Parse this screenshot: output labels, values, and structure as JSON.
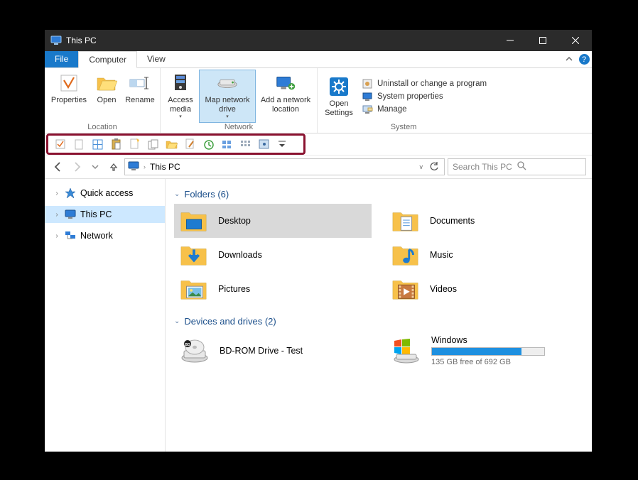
{
  "titlebar": {
    "title": "This PC"
  },
  "tabs": {
    "file": "File",
    "computer": "Computer",
    "view": "View"
  },
  "ribbon": {
    "location": {
      "label": "Location",
      "properties": "Properties",
      "open": "Open",
      "rename": "Rename"
    },
    "network": {
      "label": "Network",
      "access_media": "Access media",
      "map_drive": "Map network drive",
      "add_location": "Add a network location"
    },
    "open_settings": "Open Settings",
    "system": {
      "label": "System",
      "uninstall": "Uninstall or change a program",
      "properties": "System properties",
      "manage": "Manage"
    }
  },
  "address": {
    "location": "This PC"
  },
  "search": {
    "placeholder": "Search This PC"
  },
  "sidebar": {
    "quick_access": "Quick access",
    "this_pc": "This PC",
    "network": "Network"
  },
  "sections": {
    "folders_header": "Folders (6)",
    "devices_header": "Devices and drives (2)"
  },
  "folders": [
    {
      "name": "Desktop"
    },
    {
      "name": "Documents"
    },
    {
      "name": "Downloads"
    },
    {
      "name": "Music"
    },
    {
      "name": "Pictures"
    },
    {
      "name": "Videos"
    }
  ],
  "devices": {
    "bdrom": {
      "name": "BD-ROM Drive - Test"
    },
    "windows": {
      "name": "Windows",
      "free_text": "135 GB free of 692 GB",
      "used_percent": 80
    }
  }
}
